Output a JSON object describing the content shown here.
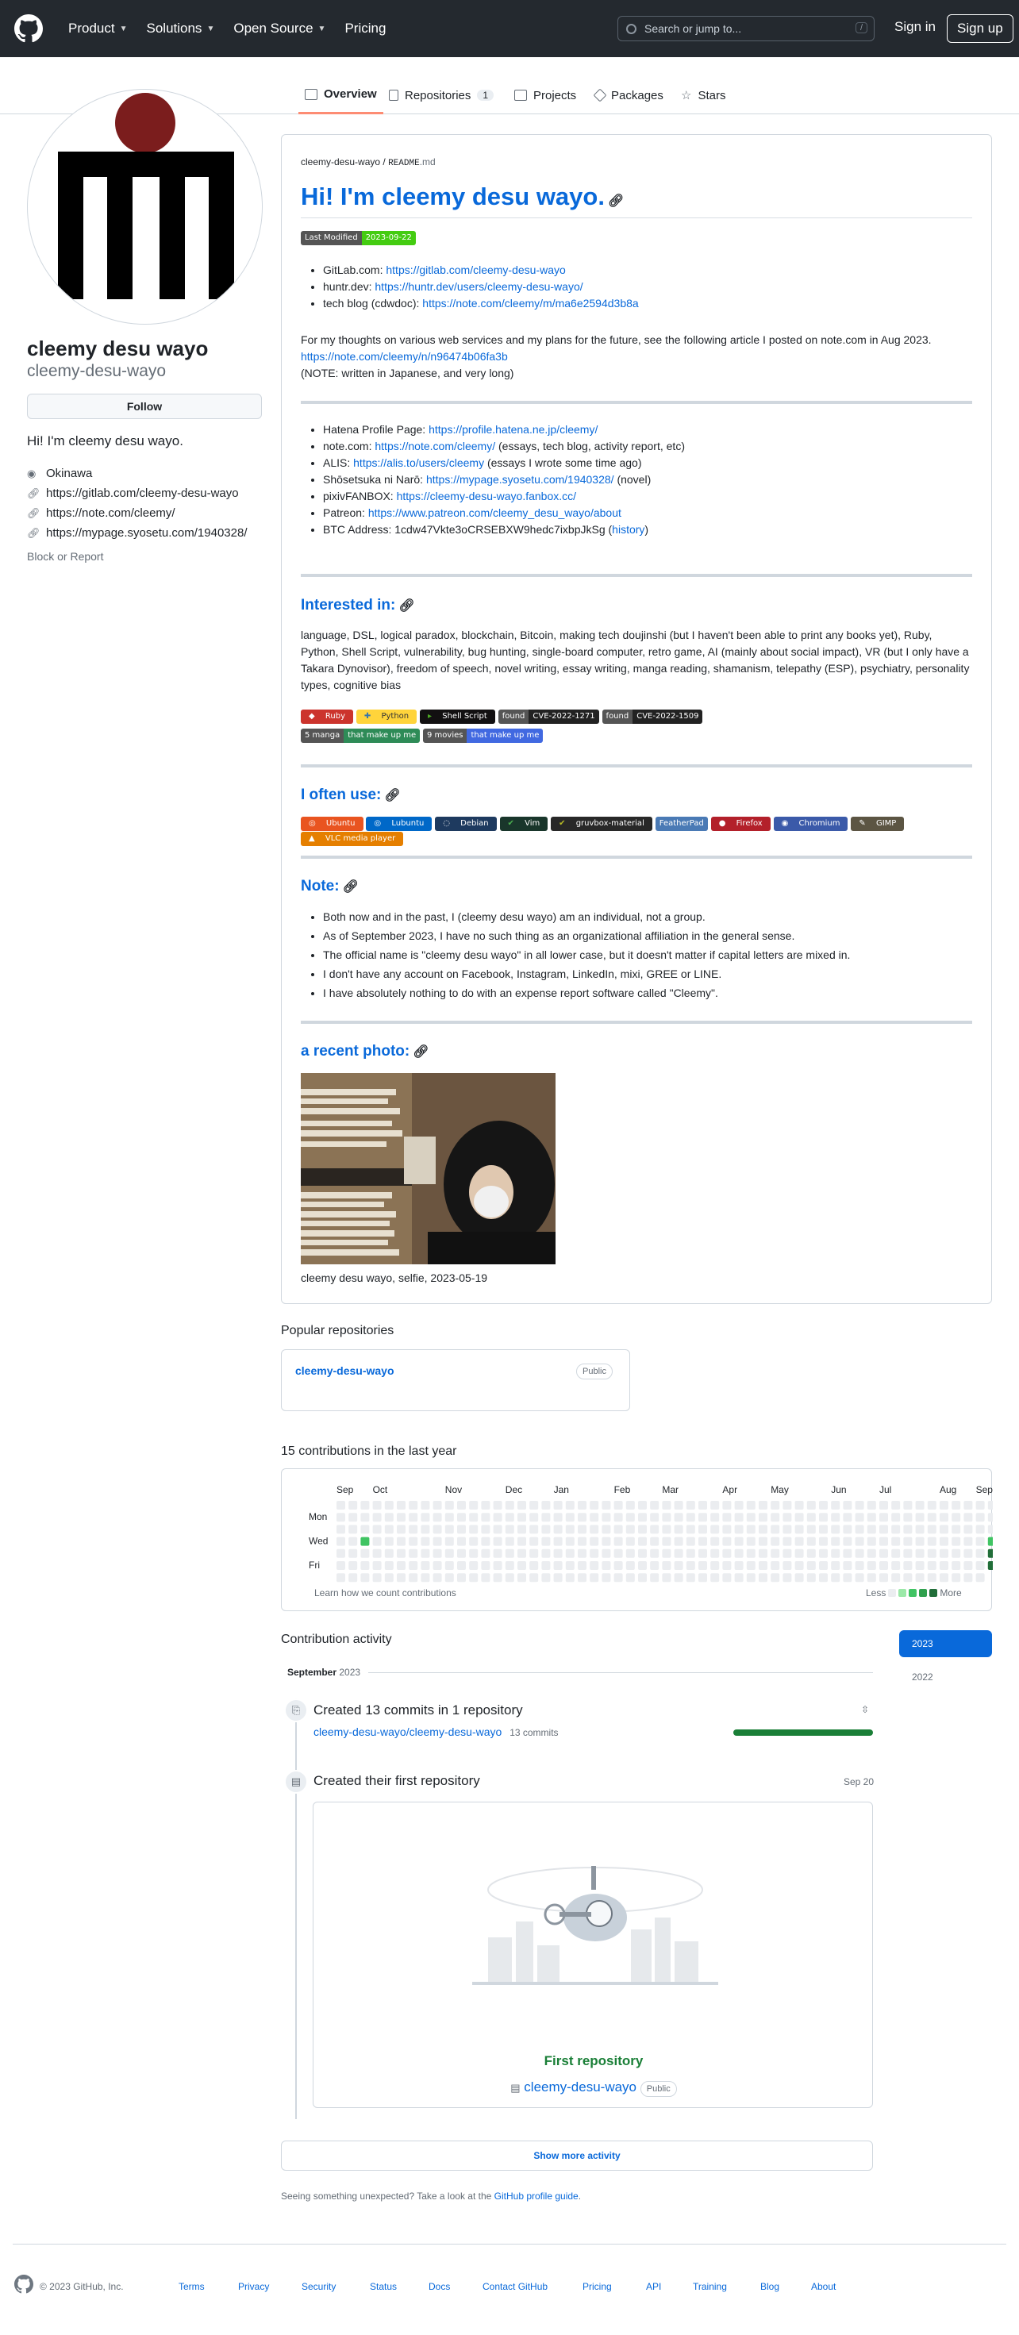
{
  "header": {
    "nav": [
      "Product",
      "Solutions",
      "Open Source",
      "Pricing"
    ],
    "search_placeholder": "Search or jump to...",
    "search_key": "/",
    "signin": "Sign in",
    "signup": "Sign up"
  },
  "tabs": {
    "overview": "Overview",
    "repositories": "Repositories",
    "repo_count": "1",
    "projects": "Projects",
    "packages": "Packages",
    "stars": "Stars"
  },
  "profile": {
    "name": "cleemy desu wayo",
    "login": "cleemy-desu-wayo",
    "follow": "Follow",
    "bio": "Hi! I'm cleemy desu wayo.",
    "location": "Okinawa",
    "links": [
      "https://gitlab.com/cleemy-desu-wayo",
      "https://note.com/cleemy/",
      "https://mypage.syosetu.com/1940328/"
    ],
    "block": "Block or Report"
  },
  "readme": {
    "path_user": "cleemy-desu-wayo",
    "path_sep": "/",
    "path_file": "README",
    "path_ext": ".md",
    "title": "Hi! I'm cleemy desu wayo.",
    "badge_label": "Last Modified",
    "badge_value": "2023-09-22",
    "list1": [
      {
        "k": "GitLab.com: ",
        "v": "https://gitlab.com/cleemy-desu-wayo"
      },
      {
        "k": "huntr.dev: ",
        "v": "https://huntr.dev/users/cleemy-desu-wayo/"
      },
      {
        "k": "tech blog (cdwdoc): ",
        "v": "https://note.com/cleemy/m/ma6e2594d3b8a"
      }
    ],
    "para1": "For my thoughts on various web services and my plans for the future, see the following article I posted on note.com in Aug 2023.",
    "para1_link": "https://note.com/cleemy/n/n96474b06fa3b",
    "para1_note": "(NOTE: written in Japanese, and very long)",
    "list2": [
      {
        "k": "Hatena Profile Page: ",
        "v": "https://profile.hatena.ne.jp/cleemy/",
        "s": ""
      },
      {
        "k": "note.com: ",
        "v": "https://note.com/cleemy/",
        "s": " (essays, tech blog, activity report, etc)"
      },
      {
        "k": "ALIS: ",
        "v": "https://alis.to/users/cleemy",
        "s": " (essays I wrote some time ago)"
      },
      {
        "k": "Shōsetsuka ni Narō: ",
        "v": "https://mypage.syosetu.com/1940328/",
        "s": " (novel)"
      },
      {
        "k": "pixivFANBOX: ",
        "v": "https://cleemy-desu-wayo.fanbox.cc/",
        "s": ""
      },
      {
        "k": "Patreon: ",
        "v": "https://www.patreon.com/cleemy_desu_wayo/about",
        "s": ""
      }
    ],
    "btc_label": "BTC Address: 1cdw47Vkte3oCRSEBXW9hedc7ixbpJkSg (",
    "btc_link": "history",
    "btc_end": ")",
    "interested_h": "Interested in:",
    "interested_text": "language, DSL, logical paradox, blockchain, Bitcoin, making tech doujinshi (but I haven't been able to print any books yet), Ruby, Python, Shell Script, vulnerability, bug hunting, single-board computer, retro game, AI (mainly about social impact), VR (but I only have a Takara Dynovisor), freedom of speech, novel writing, essay writing, manga reading, shamanism, telepathy (ESP), psychiatry, personality types, cognitive bias",
    "interest_badges": [
      "Ruby",
      "Python",
      "Shell Script"
    ],
    "cve1_l": "found",
    "cve1_v": "CVE-2022-1271",
    "cve2_l": "found",
    "cve2_v": "CVE-2022-1509",
    "manga_l": "5 manga",
    "manga_v": "that make up me",
    "movies_l": "9 movies",
    "movies_v": "that make up me",
    "use_h": "I often use:",
    "use_badges": [
      "Ubuntu",
      "Lubuntu",
      "Debian",
      "Vim",
      "gruvbox-material",
      "FeatherPad",
      "Firefox",
      "Chromium",
      "GIMP",
      "VLC media player"
    ],
    "note_h": "Note:",
    "notes": [
      "Both now and in the past, I (cleemy desu wayo) am an individual, not a group.",
      "As of September 2023, I have no such thing as an organizational affiliation in the general sense.",
      "The official name is \"cleemy desu wayo\" in all lower case, but it doesn't matter if capital letters are mixed in.",
      "I don't have any account on Facebook, Instagram, LinkedIn, mixi, GREE or LINE.",
      "I have absolutely nothing to do with an expense report software called \"Cleemy\"."
    ],
    "photo_h": "a recent photo:",
    "photo_caption": "cleemy desu wayo, selfie, 2023-05-19"
  },
  "popular": {
    "heading": "Popular repositories",
    "repo": "cleemy-desu-wayo",
    "visibility": "Public"
  },
  "contrib": {
    "heading": "15 contributions in the last year",
    "months": [
      "Sep",
      "Oct",
      "Nov",
      "Dec",
      "Jan",
      "Feb",
      "Mar",
      "Apr",
      "May",
      "Jun",
      "Jul",
      "Aug",
      "Sep"
    ],
    "days": [
      "Mon",
      "Wed",
      "Fri"
    ],
    "learn": "Learn how we count contributions",
    "less": "Less",
    "more": "More"
  },
  "activity": {
    "heading": "Contribution activity",
    "years": [
      "2023",
      "2022"
    ],
    "month": "September",
    "month_year": "2023",
    "commits_title": "Created 13 commits in 1 repository",
    "commits_repo": "cleemy-desu-wayo/cleemy-desu-wayo",
    "commits_count": "13 commits",
    "commit_ratio": 1.0,
    "first_repo": "Created their first repository",
    "first_date": "Sep 20",
    "first_repo_label": "First repository",
    "first_repo_name": "cleemy-desu-wayo",
    "first_repo_vis": "Public",
    "show_more": "Show more activity",
    "guide_pre": "Seeing something unexpected? Take a look at the ",
    "guide_link": "GitHub profile guide",
    "guide_post": "."
  },
  "footer": {
    "copyright": "© 2023 GitHub, Inc.",
    "links": [
      "Terms",
      "Privacy",
      "Security",
      "Status",
      "Docs",
      "Contact GitHub",
      "Pricing",
      "API",
      "Training",
      "Blog",
      "About"
    ]
  },
  "colors": {
    "header_bg": "#24292f",
    "link": "#0969da",
    "accent_tab": "#fd8c73",
    "green": "#1a7f37"
  }
}
